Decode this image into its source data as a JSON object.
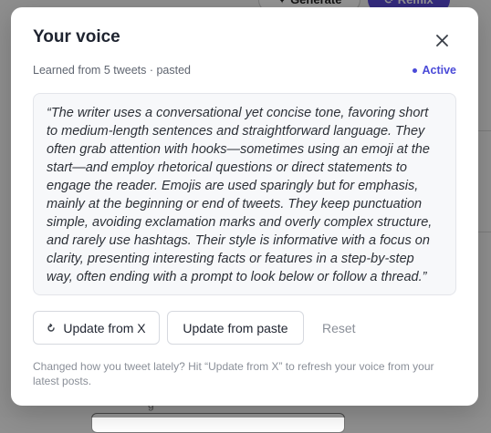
{
  "background": {
    "generate_label": "✦ Generate",
    "remix_label": "⟳ Remix",
    "partial_text": "g"
  },
  "modal": {
    "title": "Your voice",
    "close_icon": "close-icon",
    "source_meta": "Learned from 5 tweets · pasted",
    "status": "Active",
    "voice_description": "“The writer uses a conversational yet concise tone, favoring short to medium-length sentences and straightforward language. They often grab attention with hooks—sometimes using an emoji at the start—and employ rhetorical questions or direct statements to engage the reader. Emojis are used sparingly but for emphasis, mainly at the beginning or end of tweets. They keep punctuation simple, avoiding exclamation marks and overly complex structure, and rarely use hashtags. Their style is informative with a focus on clarity, presenting interesting facts or features in a step-by-step way, often ending with a prompt to look below or follow a thread.”",
    "actions": {
      "update_x_label": "Update from X",
      "update_x_icon": "refresh-icon",
      "update_paste_label": "Update from paste",
      "reset_label": "Reset"
    },
    "footnote": "Changed how you tweet lately? Hit “Update from X” to refresh your voice from your latest posts."
  },
  "colors": {
    "accent": "#4a4ad8",
    "remix_button": "#5b4ad8",
    "title_text": "#1f2430",
    "muted_text": "#8a8f98"
  }
}
